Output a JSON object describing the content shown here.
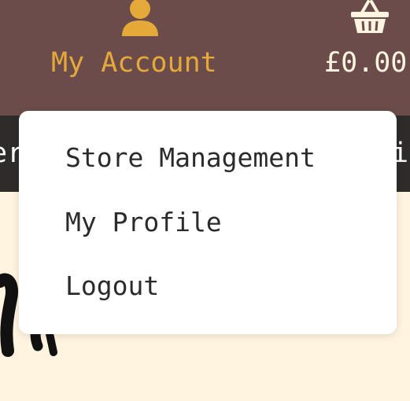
{
  "header": {
    "account": {
      "label": "My Account",
      "icon": "user-icon",
      "color": "#e5a93a"
    },
    "basket": {
      "total": "£0.00",
      "icon": "basket-icon"
    },
    "background": "#6b4c4b"
  },
  "nav": {
    "left_fragment": "er",
    "right_fragment": "iv",
    "background": "#2e2b2b"
  },
  "account_menu": {
    "items": [
      {
        "label": "Store Management"
      },
      {
        "label": "My Profile"
      },
      {
        "label": "Logout"
      }
    ]
  },
  "page": {
    "background": "#fef4df"
  }
}
